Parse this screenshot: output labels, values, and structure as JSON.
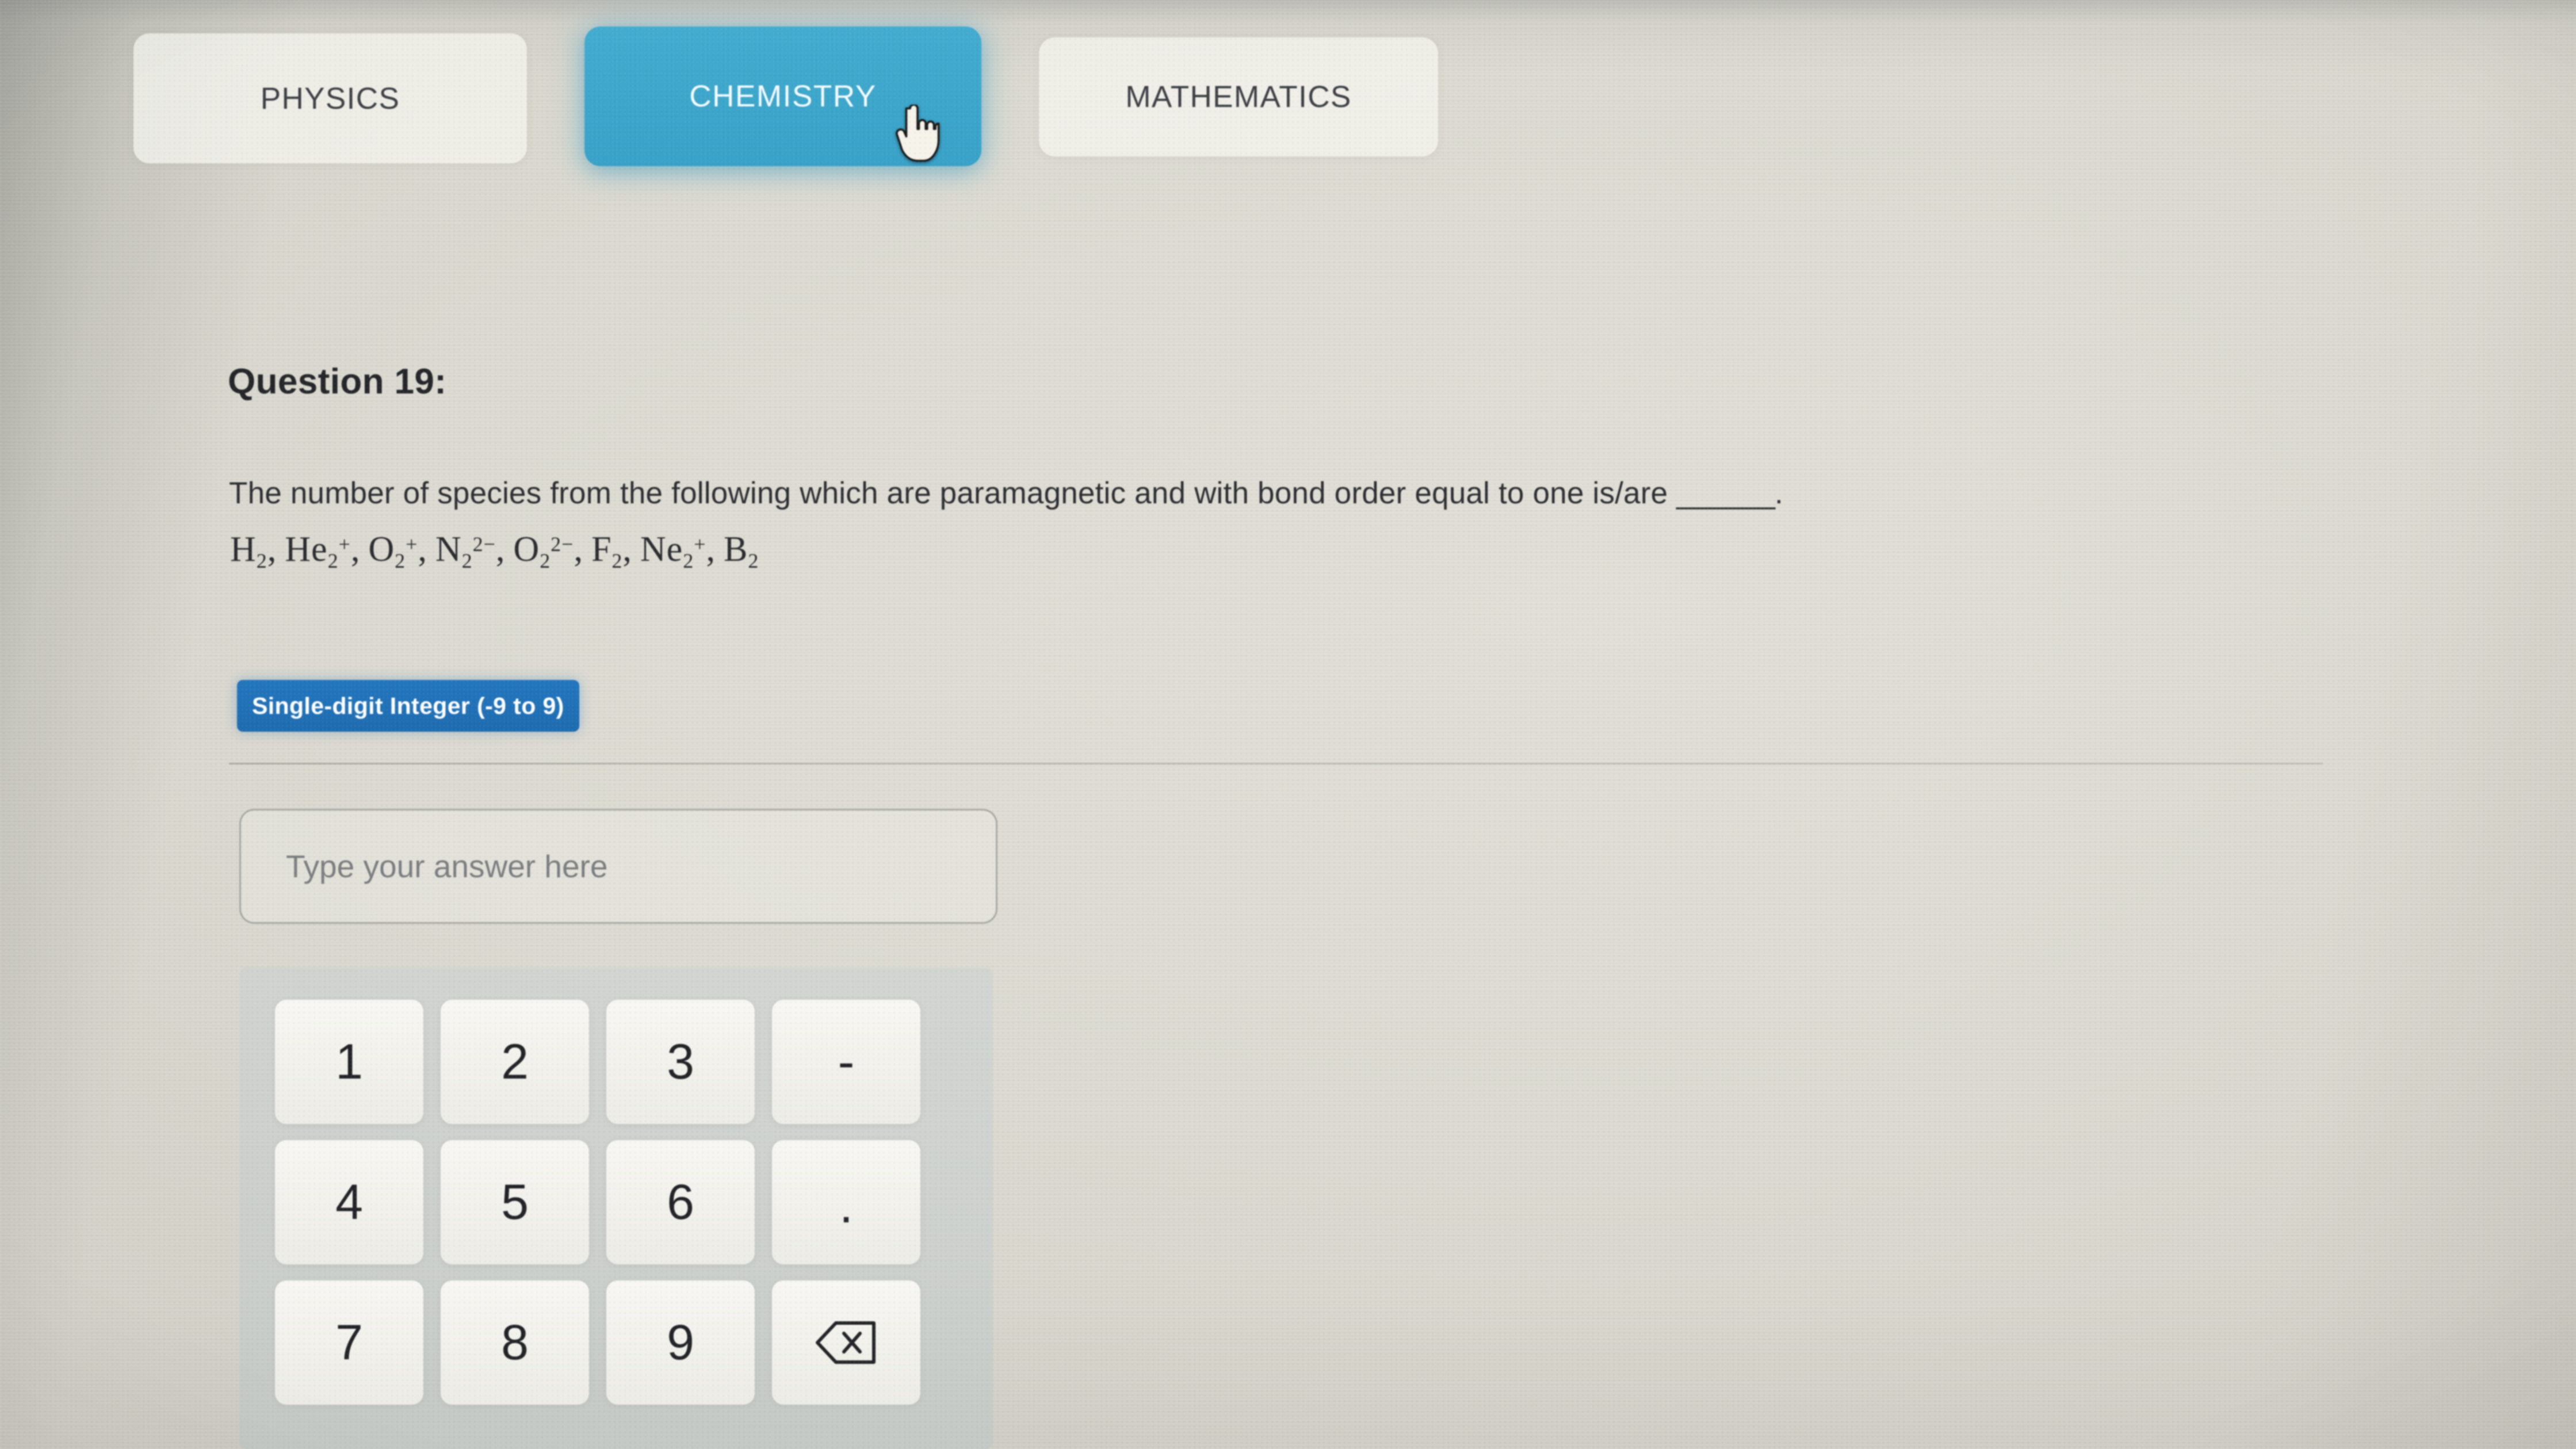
{
  "tabs": [
    {
      "label": "PHYSICS",
      "active": false
    },
    {
      "label": "CHEMISTRY",
      "active": true
    },
    {
      "label": "MATHEMATICS",
      "active": false
    }
  ],
  "cursor": {
    "icon": "pointing-hand-cursor",
    "over_tab": "CHEMISTRY"
  },
  "question": {
    "title": "Question 19:",
    "text": "The number of species from the following which are paramagnetic and with bond order equal to one is/are ______.",
    "text_before_blank": "The number of species from the following which are paramagnetic and with bond order equal to one is/are ",
    "blank": "______",
    "text_after_blank": ".",
    "species_plain": "H2, He2+, O2+, N2 2-, O2 2-, F2, Ne2+, B2",
    "species": [
      {
        "symbol": "H",
        "sub": "2",
        "sup": ""
      },
      {
        "symbol": "He",
        "sub": "2",
        "sup": "+"
      },
      {
        "symbol": "O",
        "sub": "2",
        "sup": "+"
      },
      {
        "symbol": "N",
        "sub": "2",
        "sup": "2−"
      },
      {
        "symbol": "O",
        "sub": "2",
        "sup": "2−"
      },
      {
        "symbol": "F",
        "sub": "2",
        "sup": ""
      },
      {
        "symbol": "Ne",
        "sub": "2",
        "sup": "+"
      },
      {
        "symbol": "B",
        "sub": "2",
        "sup": ""
      }
    ],
    "answer_type_badge": "Single-digit Integer (-9 to 9)"
  },
  "answer": {
    "placeholder": "Type your answer here",
    "value": ""
  },
  "keypad": {
    "rows": [
      [
        {
          "label": "1",
          "name": "key-1"
        },
        {
          "label": "2",
          "name": "key-2"
        },
        {
          "label": "3",
          "name": "key-3"
        },
        {
          "label": "-",
          "name": "key-minus"
        }
      ],
      [
        {
          "label": "4",
          "name": "key-4"
        },
        {
          "label": "5",
          "name": "key-5"
        },
        {
          "label": "6",
          "name": "key-6"
        },
        {
          "label": ".",
          "name": "key-decimal"
        }
      ],
      [
        {
          "label": "7",
          "name": "key-7"
        },
        {
          "label": "8",
          "name": "key-8"
        },
        {
          "label": "9",
          "name": "key-9"
        },
        {
          "label": "",
          "name": "key-backspace",
          "icon": "backspace-icon"
        }
      ]
    ]
  },
  "colors": {
    "active_tab": "#3da6cb",
    "badge": "#1f6cb0",
    "page_background": "#ded Cd2",
    "text": "#2d2e32",
    "keypad_panel": "#c0cacd"
  }
}
